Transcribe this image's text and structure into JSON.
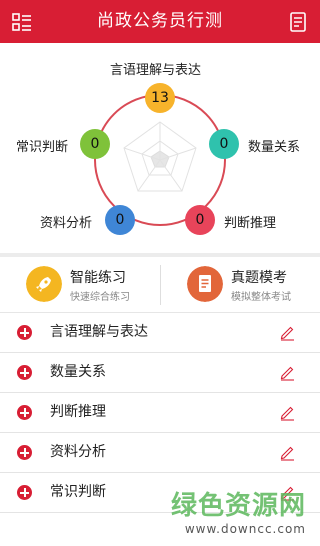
{
  "header": {
    "title": "尚政公务员行测",
    "left_icon": "menu-grid-icon",
    "right_icon": "notebook-icon",
    "color": "#d81e34"
  },
  "radar": {
    "nodes": [
      {
        "label": "言语理解与表达",
        "value": "13",
        "color": "#f7b32b"
      },
      {
        "label": "数量关系",
        "value": "0",
        "color": "#2fc2ad"
      },
      {
        "label": "判断推理",
        "value": "0",
        "color": "#e8445a"
      },
      {
        "label": "资料分析",
        "value": "0",
        "color": "#3f86d6"
      },
      {
        "label": "常识判断",
        "value": "0",
        "color": "#7fc23a"
      }
    ]
  },
  "cards": [
    {
      "title": "智能练习",
      "subtitle": "快速综合练习",
      "icon": "rocket-icon",
      "color": "#f4b621"
    },
    {
      "title": "真题模考",
      "subtitle": "模拟整体考试",
      "icon": "document-icon",
      "color": "#e2663a"
    }
  ],
  "list": [
    {
      "label": "言语理解与表达"
    },
    {
      "label": "数量关系"
    },
    {
      "label": "判断推理"
    },
    {
      "label": "资料分析"
    },
    {
      "label": "常识判断"
    }
  ],
  "watermark": {
    "big": "绿色资源网",
    "small": "www.downcc.com"
  }
}
